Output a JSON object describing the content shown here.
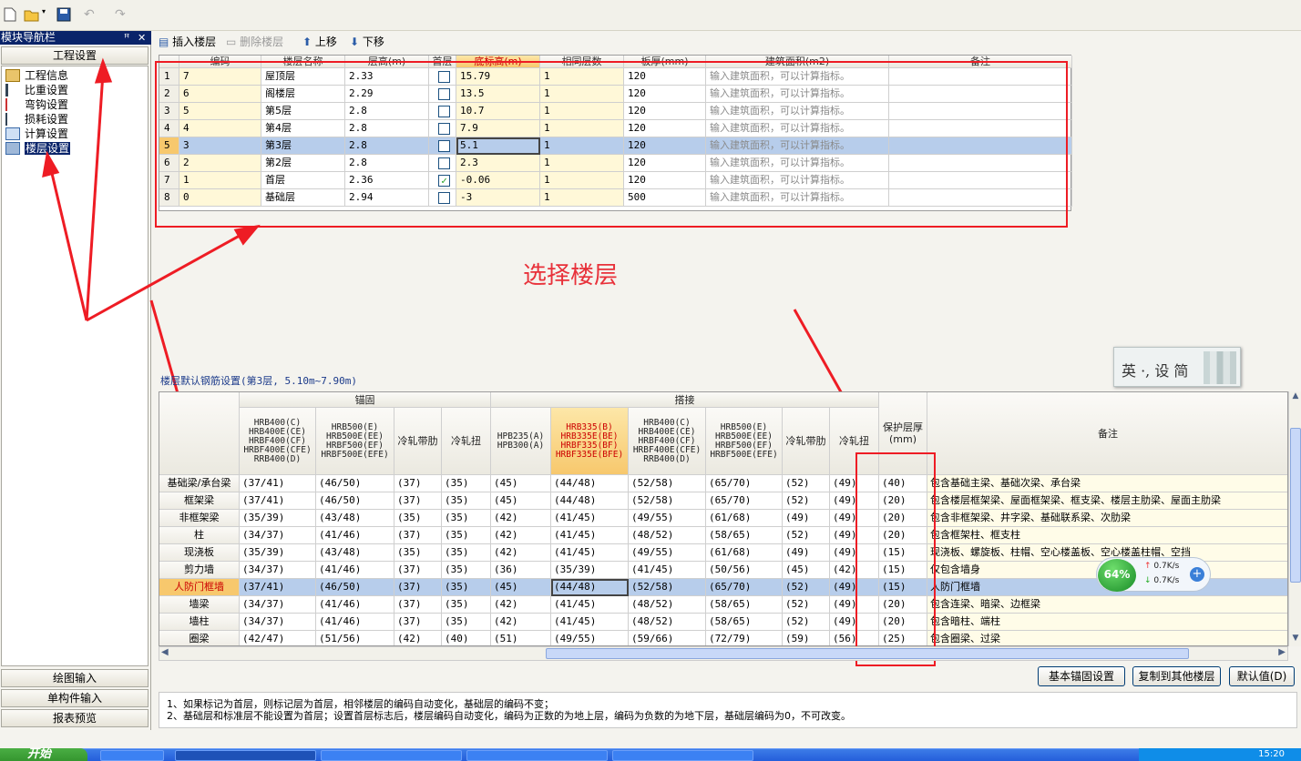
{
  "nav": {
    "title": "模块导航栏",
    "pin": "ꟸ",
    "close": "✕",
    "section": "工程设置",
    "items": [
      "工程信息",
      "比重设置",
      "弯钩设置",
      "损耗设置",
      "计算设置",
      "楼层设置"
    ],
    "bottom": [
      "绘图输入",
      "单构件输入",
      "报表预览"
    ]
  },
  "floor_toolbar": {
    "insert": "插入楼层",
    "delete": "删除楼层",
    "up": "上移",
    "down": "下移"
  },
  "floor_table": {
    "headers": [
      "编码",
      "楼层名称",
      "层高(m)",
      "首层",
      "底标高(m)",
      "相同层数",
      "板厚(mm)",
      "建筑面积(m2)",
      "备注"
    ],
    "rows": [
      {
        "n": "1",
        "code": "7",
        "name": "屋顶层",
        "height": "2.33",
        "first": false,
        "bottom": "15.79",
        "same": "1",
        "thick": "120",
        "area": "输入建筑面积，可以计算指标。",
        "note": ""
      },
      {
        "n": "2",
        "code": "6",
        "name": "阁楼层",
        "height": "2.29",
        "first": false,
        "bottom": "13.5",
        "same": "1",
        "thick": "120",
        "area": "输入建筑面积，可以计算指标。",
        "note": ""
      },
      {
        "n": "3",
        "code": "5",
        "name": "第5层",
        "height": "2.8",
        "first": false,
        "bottom": "10.7",
        "same": "1",
        "thick": "120",
        "area": "输入建筑面积，可以计算指标。",
        "note": ""
      },
      {
        "n": "4",
        "code": "4",
        "name": "第4层",
        "height": "2.8",
        "first": false,
        "bottom": "7.9",
        "same": "1",
        "thick": "120",
        "area": "输入建筑面积，可以计算指标。",
        "note": ""
      },
      {
        "n": "5",
        "code": "3",
        "name": "第3层",
        "height": "2.8",
        "first": false,
        "bottom": "5.1",
        "same": "1",
        "thick": "120",
        "area": "输入建筑面积，可以计算指标。",
        "note": ""
      },
      {
        "n": "6",
        "code": "2",
        "name": "第2层",
        "height": "2.8",
        "first": false,
        "bottom": "2.3",
        "same": "1",
        "thick": "120",
        "area": "输入建筑面积，可以计算指标。",
        "note": ""
      },
      {
        "n": "7",
        "code": "1",
        "name": "首层",
        "height": "2.36",
        "first": true,
        "bottom": "-0.06",
        "same": "1",
        "thick": "120",
        "area": "输入建筑面积，可以计算指标。",
        "note": ""
      },
      {
        "n": "8",
        "code": "0",
        "name": "基础层",
        "height": "2.94",
        "first": false,
        "bottom": "-3",
        "same": "1",
        "thick": "500",
        "area": "输入建筑面积，可以计算指标。",
        "note": ""
      }
    ]
  },
  "annotation": "选择楼层",
  "ime": {
    "text": "英 ·, 设 简"
  },
  "rebar": {
    "title": "楼层默认钢筋设置(第3层, 5.10m~7.90m)",
    "group_anchor": "锚固",
    "group_lap": "搭接",
    "headers": [
      "HRB400(C)\nHRB400E(CE)\nHRBF400(CF)\nHRBF400E(CFE)\nRRB400(D)",
      "HRB500(E)\nHRB500E(EE)\nHRBF500(EF)\nHRBF500E(EFE)",
      "冷轧带肋",
      "冷轧扭",
      "HPB235(A)\nHPB300(A)",
      "HRB335(B)\nHRB335E(BE)\nHRBF335(BF)\nHRBF335E(BFE)",
      "HRB400(C)\nHRB400E(CE)\nHRBF400(CF)\nHRBF400E(CFE)\nRRB400(D)",
      "HRB500(E)\nHRB500E(EE)\nHRBF500(EF)\nHRBF500E(EFE)",
      "冷轧带肋",
      "冷轧扭",
      "保护层厚\n(mm)",
      "备注"
    ],
    "rows": [
      {
        "name": "基础梁/承台梁",
        "v": [
          "(37/41)",
          "(46/50)",
          "(37)",
          "(35)",
          "(45)",
          "(44/48)",
          "(52/58)",
          "(65/70)",
          "(52)",
          "(49)",
          "(40)"
        ],
        "note": "包含基础主梁、基础次梁、承台梁"
      },
      {
        "name": "框架梁",
        "v": [
          "(37/41)",
          "(46/50)",
          "(37)",
          "(35)",
          "(45)",
          "(44/48)",
          "(52/58)",
          "(65/70)",
          "(52)",
          "(49)",
          "(20)"
        ],
        "note": "包含楼层框架梁、屋面框架梁、框支梁、楼层主肋梁、屋面主肋梁"
      },
      {
        "name": "非框架梁",
        "v": [
          "(35/39)",
          "(43/48)",
          "(35)",
          "(35)",
          "(42)",
          "(41/45)",
          "(49/55)",
          "(61/68)",
          "(49)",
          "(49)",
          "(20)"
        ],
        "note": "包含非框架梁、井字梁、基础联系梁、次肋梁"
      },
      {
        "name": "柱",
        "v": [
          "(34/37)",
          "(41/46)",
          "(37)",
          "(35)",
          "(42)",
          "(41/45)",
          "(48/52)",
          "(58/65)",
          "(52)",
          "(49)",
          "(20)"
        ],
        "note": "包含框架柱、框支柱"
      },
      {
        "name": "现浇板",
        "v": [
          "(35/39)",
          "(43/48)",
          "(35)",
          "(35)",
          "(42)",
          "(41/45)",
          "(49/55)",
          "(61/68)",
          "(49)",
          "(49)",
          "(15)"
        ],
        "note": "现浇板、螺旋板、柱帽、空心楼盖板、空心楼盖柱帽、空挡"
      },
      {
        "name": "剪力墙",
        "v": [
          "(34/37)",
          "(41/46)",
          "(37)",
          "(35)",
          "(36)",
          "(35/39)",
          "(41/45)",
          "(50/56)",
          "(45)",
          "(42)",
          "(15)"
        ],
        "note": "仅包含墙身"
      },
      {
        "name": "人防门框墙",
        "v": [
          "(37/41)",
          "(46/50)",
          "(37)",
          "(35)",
          "(45)",
          "(44/48)",
          "(52/58)",
          "(65/70)",
          "(52)",
          "(49)",
          "(15)"
        ],
        "note": "人防门框墙"
      },
      {
        "name": "墙梁",
        "v": [
          "(34/37)",
          "(41/46)",
          "(37)",
          "(35)",
          "(42)",
          "(41/45)",
          "(48/52)",
          "(58/65)",
          "(52)",
          "(49)",
          "(20)"
        ],
        "note": "包含连梁、暗梁、边框梁"
      },
      {
        "name": "墙柱",
        "v": [
          "(34/37)",
          "(41/46)",
          "(37)",
          "(35)",
          "(42)",
          "(41/45)",
          "(48/52)",
          "(58/65)",
          "(52)",
          "(49)",
          "(20)"
        ],
        "note": "包含暗柱、端柱"
      },
      {
        "name": "圈梁",
        "v": [
          "(42/47)",
          "(51/56)",
          "(42)",
          "(40)",
          "(51)",
          "(49/55)",
          "(59/66)",
          "(72/79)",
          "(59)",
          "(56)",
          "(25)"
        ],
        "note": "包含圈梁、过梁"
      }
    ]
  },
  "net_widget": {
    "percent": "64%",
    "up": "0.7K/s",
    "down": "0.7K/s"
  },
  "buttons": {
    "basic": "基本锚固设置",
    "copy": "复制到其他楼层",
    "default": "默认值(D)"
  },
  "notes": [
    "1、如果标记为首层，则标记层为首层，相邻楼层的编码自动变化，基础层的编码不变；",
    "2、基础层和标准层不能设置为首层；设置首层标志后，楼层编码自动变化，编码为正数的为地上层，编码为负数的为地下层，基础层编码为0，不可改变。"
  ],
  "taskbar": {
    "start": "开始",
    "clock": "15:20"
  }
}
